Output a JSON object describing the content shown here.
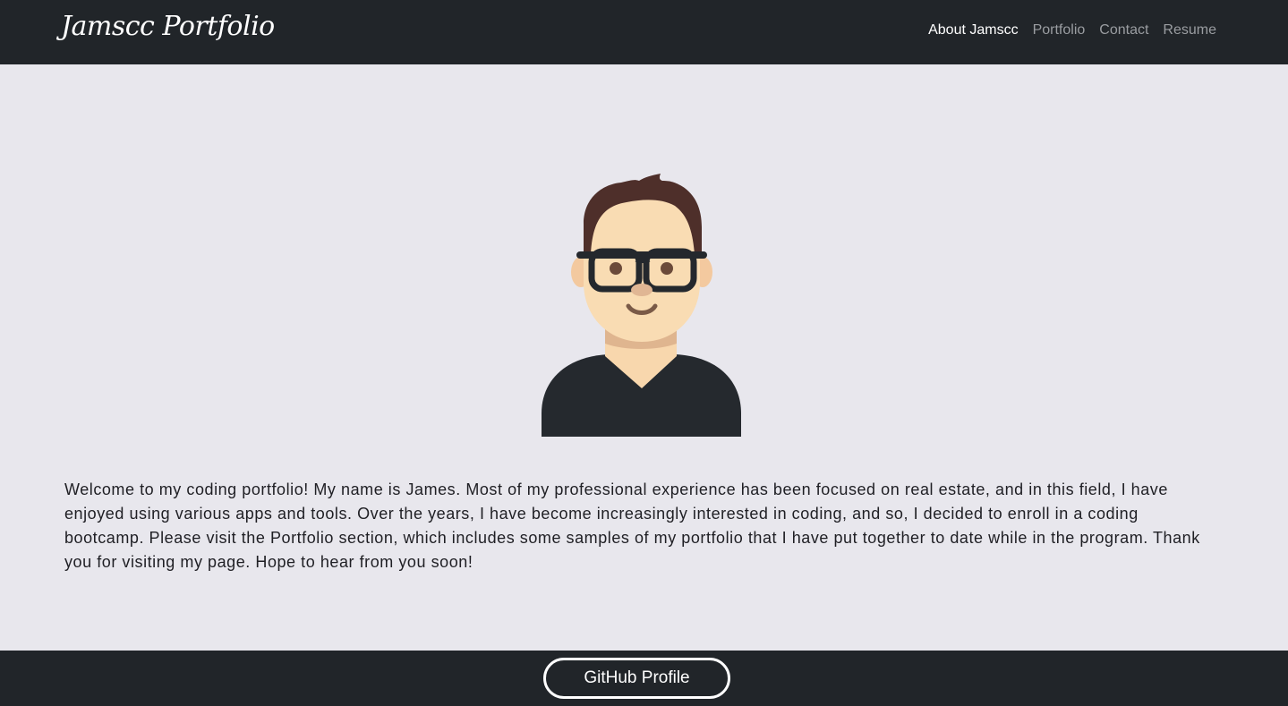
{
  "navbar": {
    "brand": "Jamscc Portfolio",
    "links": [
      {
        "label": "About Jamscc",
        "active": true
      },
      {
        "label": "Portfolio",
        "active": false
      },
      {
        "label": "Contact",
        "active": false
      },
      {
        "label": "Resume",
        "active": false
      }
    ]
  },
  "main": {
    "avatar_icon": "developer-avatar-illustration",
    "bio": "Welcome to my coding portfolio! My name is James. Most of my professional experience has been focused on real estate, and in this field, I have enjoyed using various apps and tools. Over the years, I have become increasingly interested in coding, and so, I decided to enroll in a coding bootcamp. Please visit the Portfolio section, which includes some samples of my portfolio that I have put together to date while in the program. Thank you for visiting my page. Hope to hear from you soon!"
  },
  "footer": {
    "github_label": "GitHub Profile"
  },
  "colors": {
    "navbar_bg": "#212529",
    "page_bg": "#e8e7ed",
    "nav_active": "#ffffff",
    "nav_inactive": "#9a9da1"
  }
}
